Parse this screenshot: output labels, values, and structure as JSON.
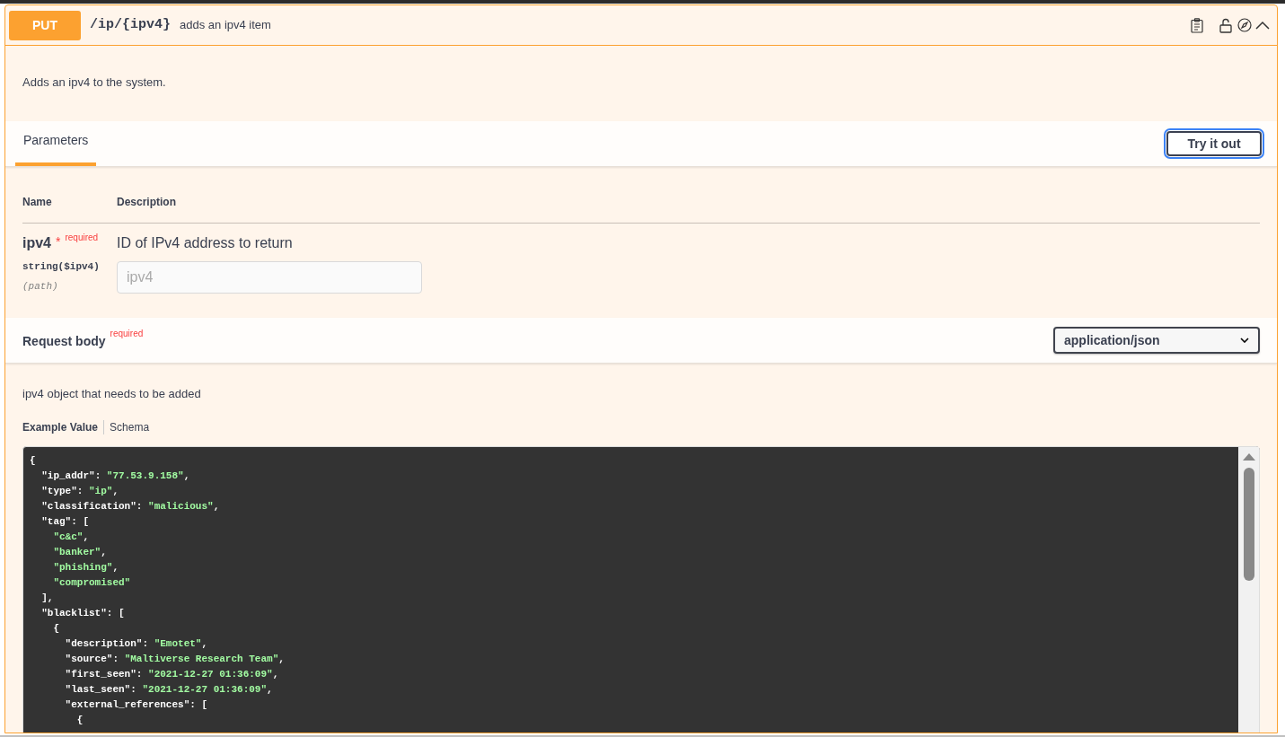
{
  "operation": {
    "method": "PUT",
    "path": "/ip/{ipv4}",
    "summary": "adds an ipv4 item",
    "expanded": true
  },
  "description": "Adds an ipv4 to the system.",
  "tabs": [
    {
      "label": "Parameters",
      "selected": true
    }
  ],
  "try_button": "Try it out",
  "parameters": {
    "columns": [
      "Name",
      "Description"
    ],
    "rows": [
      {
        "name": "ipv4",
        "star": "*",
        "required": "required",
        "type": "string($ipv4)",
        "location": "(path)",
        "description": "ID of IPv4 address to return",
        "placeholder": "ipv4"
      }
    ]
  },
  "request_body": {
    "title": "Request body",
    "required": "required",
    "content_type": "application/json",
    "description": "ipv4 object that needs to be added",
    "views": [
      {
        "label": "Example Value",
        "selected": true
      },
      {
        "label": "Schema",
        "selected": false
      }
    ],
    "code_lines": [
      "{",
      "  \"ip_addr\": \"77.53.9.158\",",
      "  \"type\": \"ip\",",
      "  \"classification\": \"malicious\",",
      "  \"tag\": [",
      "    \"c&c\",",
      "    \"banker\",",
      "    \"phishing\",",
      "    \"compromised\"",
      "  ],",
      "  \"blacklist\": [",
      "    {",
      "      \"description\": \"Emotet\",",
      "      \"source\": \"Maltiverse Research Team\",",
      "      \"first_seen\": \"2021-12-27 01:36:09\",",
      "      \"last_seen\": \"2021-12-27 01:36:09\",",
      "      \"external_references\": [",
      "        {"
    ]
  }
}
